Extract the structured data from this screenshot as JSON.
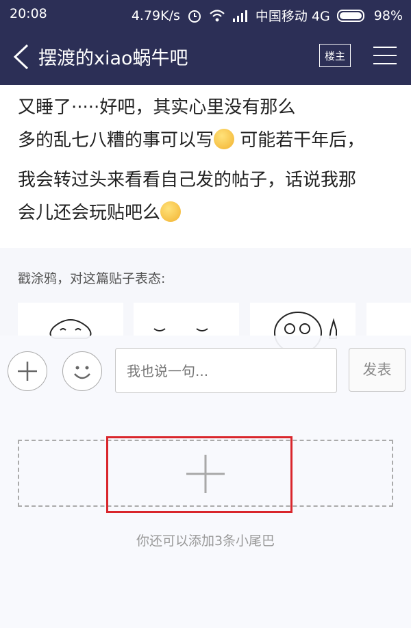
{
  "statusbar": {
    "time": "20:08",
    "speed": "4.79K/s",
    "carrier": "中国移动 4G",
    "battery": "98%"
  },
  "nav": {
    "title": "摆渡的xiao蜗牛吧",
    "louzhu_label": "楼主"
  },
  "post": {
    "line1": "又睡了·····好吧，其实心里没有那么",
    "line2a": "多的乱七八糟的事可以写",
    "line2b": "可能若干年后，",
    "line3": "我会转过头来看看自己发的帖子，话说我那",
    "line4": "会儿还会玩贴吧么"
  },
  "tuya": {
    "label": "戳涂鸦，对这篇贴子表态:"
  },
  "reply": {
    "placeholder": "我也说一句...",
    "send_label": "发表"
  },
  "tail": {
    "hint": "你还可以添加3条小尾巴"
  },
  "colors": {
    "header_bg": "#2c2f56",
    "highlight": "#d9262c"
  }
}
